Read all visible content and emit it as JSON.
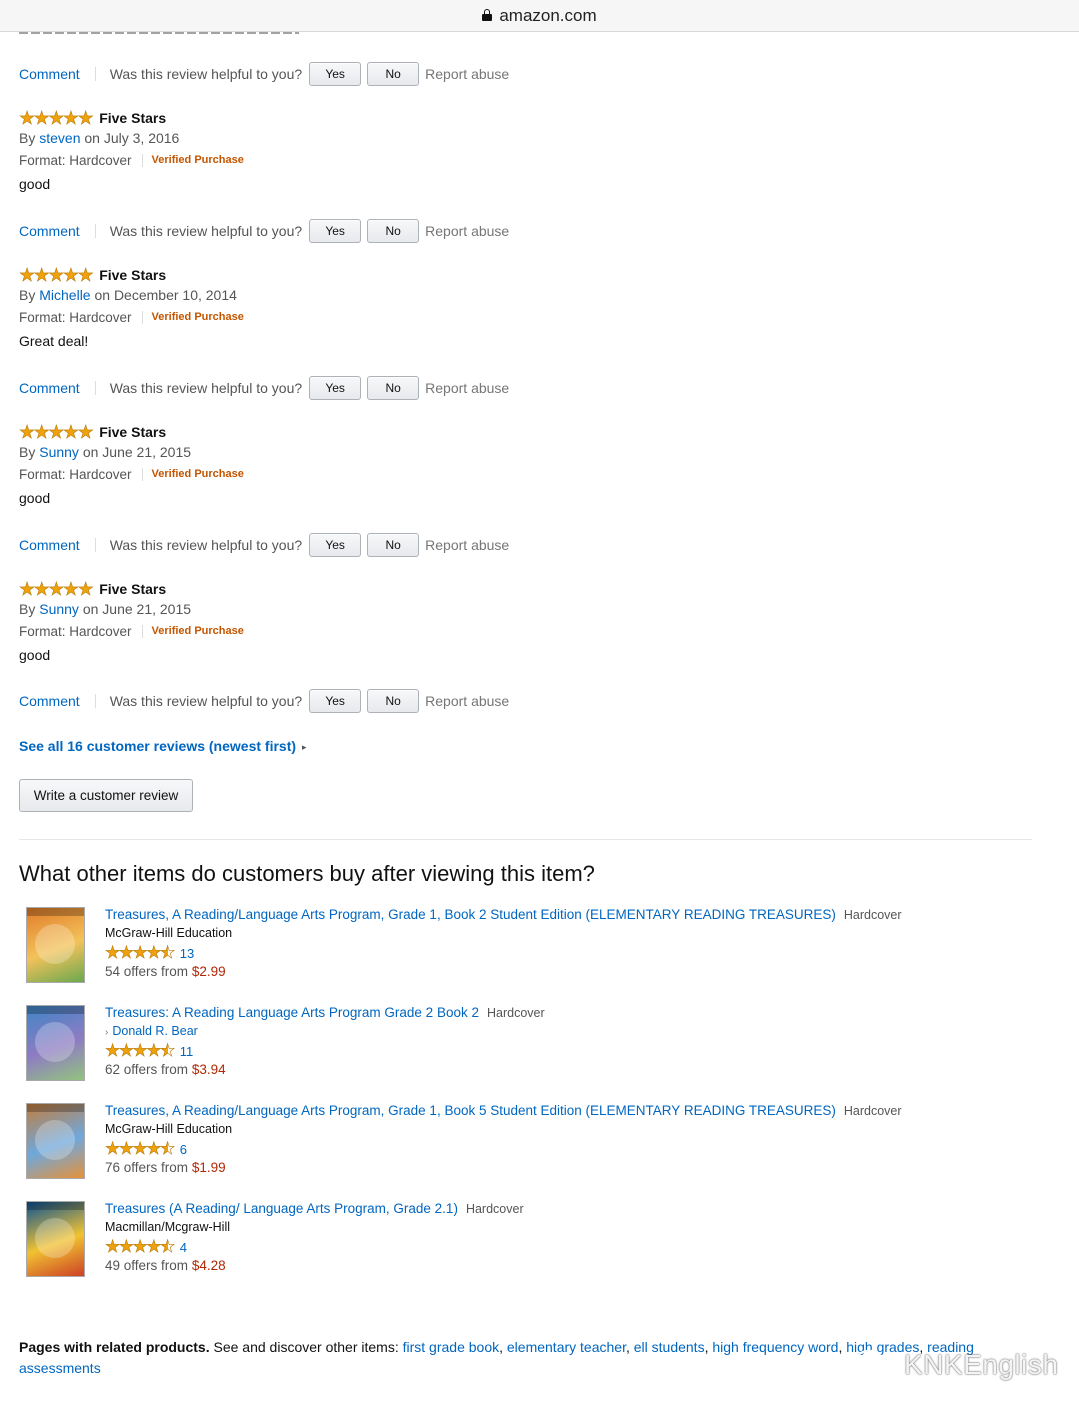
{
  "browser": {
    "url": "amazon.com"
  },
  "vote": {
    "comment_label": "Comment",
    "question": "Was this review helpful to you?",
    "yes_label": "Yes",
    "no_label": "No",
    "report_label": "Report abuse"
  },
  "reviews": [
    {
      "rating": 5,
      "title": "Five Stars",
      "by": "By",
      "author": "steven",
      "date": "on July 3, 2016",
      "format": "Format: Hardcover",
      "verified": "Verified Purchase",
      "body": "good"
    },
    {
      "rating": 5,
      "title": "Five Stars",
      "by": "By",
      "author": "Michelle",
      "date": "on December 10, 2014",
      "format": "Format: Hardcover",
      "verified": "Verified Purchase",
      "body": "Great deal!"
    },
    {
      "rating": 5,
      "title": "Five Stars",
      "by": "By",
      "author": "Sunny",
      "date": "on June 21, 2015",
      "format": "Format: Hardcover",
      "verified": "Verified Purchase",
      "body": "good"
    },
    {
      "rating": 5,
      "title": "Five Stars",
      "by": "By",
      "author": "Sunny",
      "date": "on June 21, 2015",
      "format": "Format: Hardcover",
      "verified": "Verified Purchase",
      "body": "good"
    }
  ],
  "see_all_label": "See all 16 customer reviews (newest first)",
  "write_review_label": "Write a customer review",
  "section_title": "What other items do customers buy after viewing this item?",
  "items": [
    {
      "title": "Treasures, A Reading/Language Arts Program, Grade 1, Book 2 Student Edition (ELEMENTARY READING TREASURES)",
      "format": "Hardcover",
      "publisher": "McGraw-Hill Education",
      "rating": 4.5,
      "reviews": "13",
      "offers_prefix": "54 offers from",
      "price": "$2.99",
      "cover_colors": [
        "#e07b2a",
        "#f3c25a",
        "#6aa84f"
      ]
    },
    {
      "title": "Treasures: A Reading Language Arts Program Grade 2 Book 2",
      "format": "Hardcover",
      "publisher": "Donald R. Bear",
      "rating": 4.5,
      "reviews": "11",
      "offers_prefix": "62 offers from",
      "price": "$3.94",
      "cover_colors": [
        "#3d85c6",
        "#8e7cc3",
        "#93c47d"
      ]
    },
    {
      "title": "Treasures, A Reading/Language Arts Program, Grade 1, Book 5 Student Edition (ELEMENTARY READING TREASURES)",
      "format": "Hardcover",
      "publisher": "McGraw-Hill Education",
      "rating": 4.5,
      "reviews": "6",
      "offers_prefix": "76 offers from",
      "price": "$1.99",
      "cover_colors": [
        "#c27c3e",
        "#6fa8dc",
        "#e69138"
      ]
    },
    {
      "title": "Treasures (A Reading/ Language Arts Program, Grade 2.1)",
      "format": "Hardcover",
      "publisher": "Macmillan/Mcgraw-Hill",
      "rating": 4.5,
      "reviews": "4",
      "offers_prefix": "49 offers from",
      "price": "$4.28",
      "cover_colors": [
        "#0b5394",
        "#f1c232",
        "#cc4125"
      ]
    }
  ],
  "related": {
    "lead": "Pages with related products.",
    "text": " See and discover other items: ",
    "links": [
      "first grade book",
      "elementary teacher",
      "ell students",
      "high frequency word",
      "high grades",
      "reading assessments"
    ]
  },
  "watermark": "KNKEnglish",
  "colors": {
    "link": "#0066c0",
    "verified": "#c45500",
    "price": "#b12704",
    "star": "#f0a20c"
  }
}
